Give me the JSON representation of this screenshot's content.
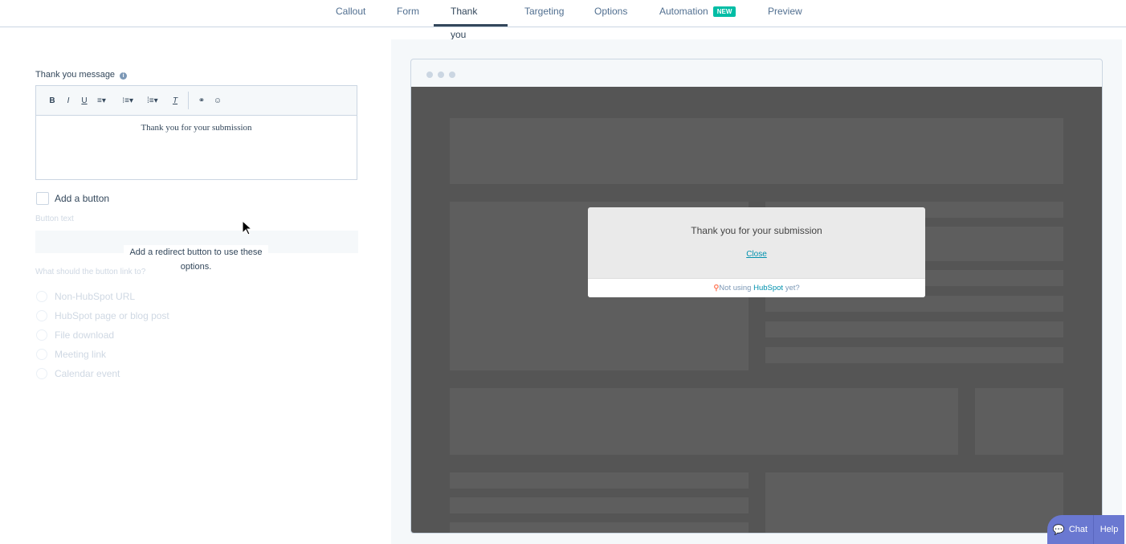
{
  "tabs": [
    {
      "label": "Callout"
    },
    {
      "label": "Form"
    },
    {
      "label": "Thank you"
    },
    {
      "label": "Targeting"
    },
    {
      "label": "Options"
    },
    {
      "label": "Automation",
      "badge": "NEW"
    },
    {
      "label": "Preview"
    }
  ],
  "form": {
    "message_label": "Thank you message",
    "toolbar": {
      "bold": "B",
      "italic": "I",
      "underline": "U",
      "clear": "T"
    },
    "message": "Thank you for your submission",
    "add_button_label": "Add a button",
    "button_text_label": "Button text",
    "redirect_hint": "Add a redirect button to use these options.",
    "link_question": "What should the button link to?",
    "link_options": [
      "Non-HubSpot URL",
      "HubSpot page or blog post",
      "File download",
      "Meeting link",
      "Calendar event"
    ]
  },
  "preview": {
    "message": "Thank you for your submission",
    "close": "Close",
    "footer_prefix": "Not using ",
    "footer_brand": "HubSpot",
    "footer_suffix": " yet?"
  },
  "chat": {
    "chat": "Chat",
    "help": "Help"
  }
}
